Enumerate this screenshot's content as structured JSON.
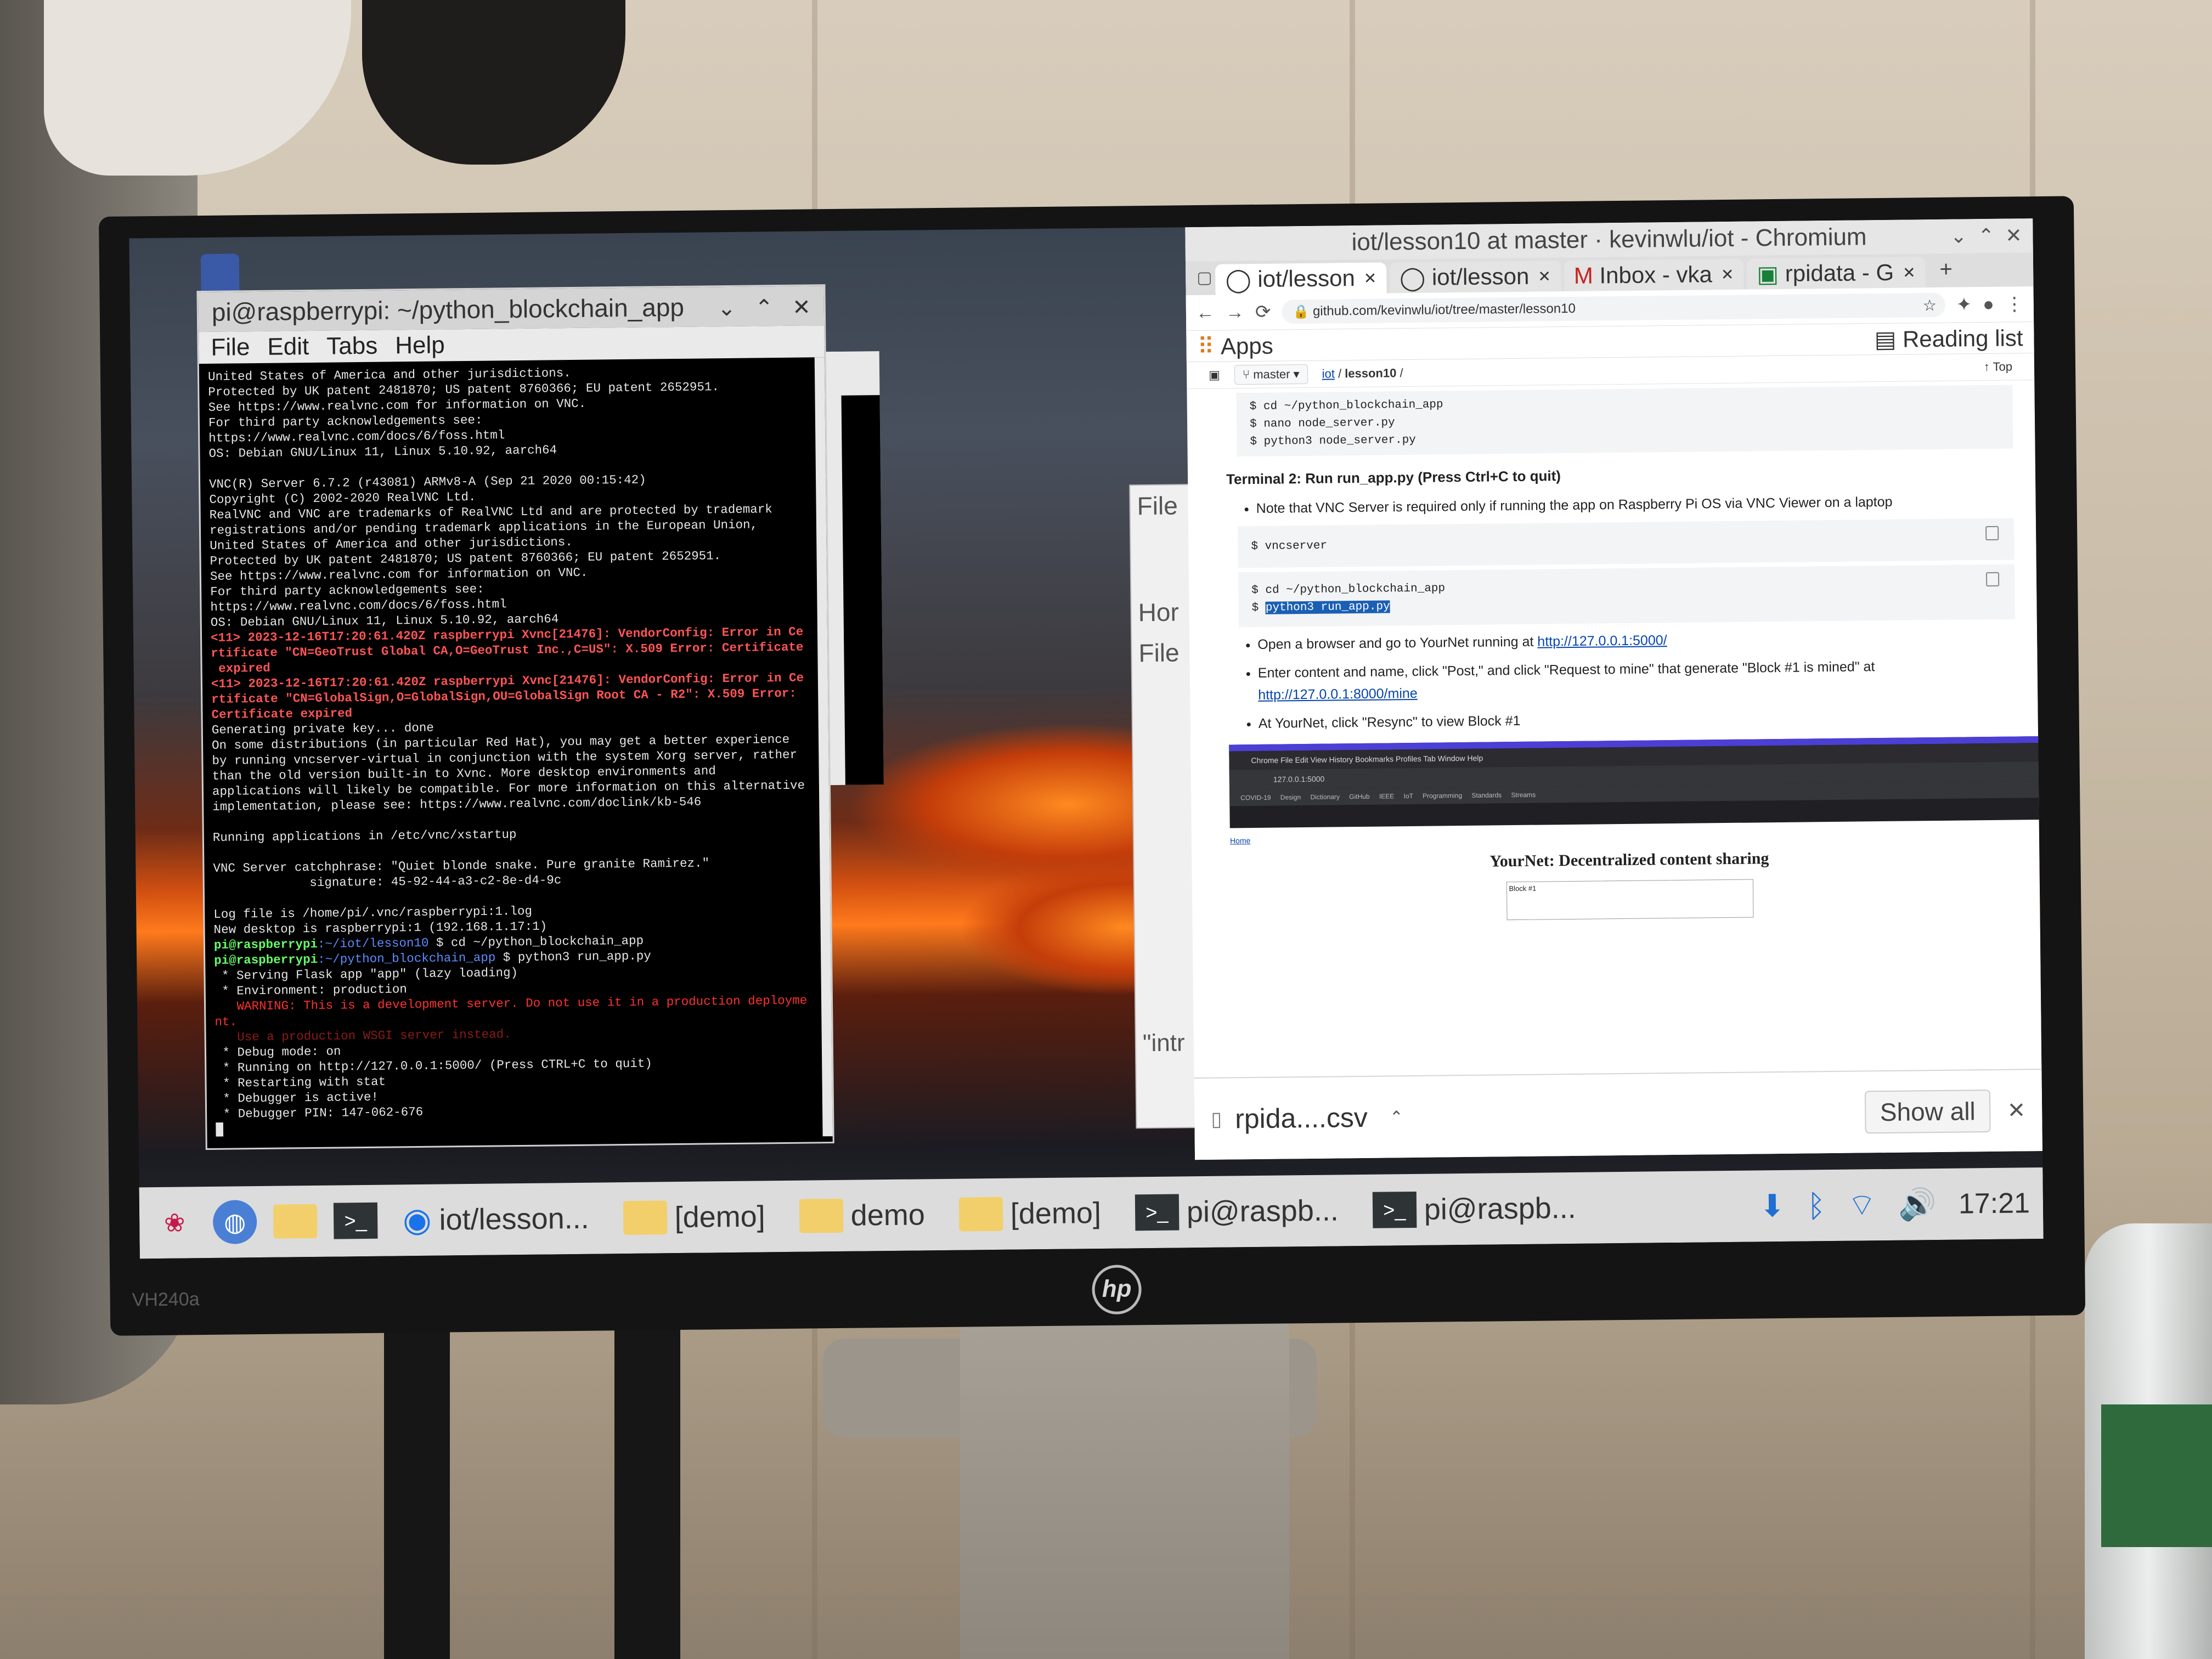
{
  "terminal": {
    "title": "pi@raspberrypi: ~/python_blockchain_app",
    "menu": [
      "File",
      "Edit",
      "Tabs",
      "Help"
    ],
    "lines": [
      {
        "t": "United States of America and other jurisdictions.",
        "c": ""
      },
      {
        "t": "Protected by UK patent 2481870; US patent 8760366; EU patent 2652951.",
        "c": ""
      },
      {
        "t": "See https://www.realvnc.com for information on VNC.",
        "c": ""
      },
      {
        "t": "For third party acknowledgements see:",
        "c": ""
      },
      {
        "t": "https://www.realvnc.com/docs/6/foss.html",
        "c": ""
      },
      {
        "t": "OS: Debian GNU/Linux 11, Linux 5.10.92, aarch64",
        "c": ""
      },
      {
        "t": "",
        "c": ""
      },
      {
        "t": "VNC(R) Server 6.7.2 (r43081) ARMv8-A (Sep 21 2020 00:15:42)",
        "c": ""
      },
      {
        "t": "Copyright (C) 2002-2020 RealVNC Ltd.",
        "c": ""
      },
      {
        "t": "RealVNC and VNC are trademarks of RealVNC Ltd and are protected by trademark",
        "c": ""
      },
      {
        "t": "registrations and/or pending trademark applications in the European Union,",
        "c": ""
      },
      {
        "t": "United States of America and other jurisdictions.",
        "c": ""
      },
      {
        "t": "Protected by UK patent 2481870; US patent 8760366; EU patent 2652951.",
        "c": ""
      },
      {
        "t": "See https://www.realvnc.com for information on VNC.",
        "c": ""
      },
      {
        "t": "For third party acknowledgements see:",
        "c": ""
      },
      {
        "t": "https://www.realvnc.com/docs/6/foss.html",
        "c": ""
      },
      {
        "t": "OS: Debian GNU/Linux 11, Linux 5.10.92, aarch64",
        "c": ""
      },
      {
        "t": "<11> 2023-12-16T17:20:61.420Z raspberrypi Xvnc[21476]: VendorConfig: Error in Ce",
        "c": "red"
      },
      {
        "t": "rtificate \"CN=GeoTrust Global CA,O=GeoTrust Inc.,C=US\": X.509 Error: Certificate",
        "c": "red"
      },
      {
        "t": " expired",
        "c": "red"
      },
      {
        "t": "<11> 2023-12-16T17:20:61.420Z raspberrypi Xvnc[21476]: VendorConfig: Error in Ce",
        "c": "red"
      },
      {
        "t": "rtificate \"CN=GlobalSign,O=GlobalSign,OU=GlobalSign Root CA - R2\": X.509 Error:",
        "c": "red"
      },
      {
        "t": "Certificate expired",
        "c": "red"
      },
      {
        "t": "Generating private key... done",
        "c": ""
      },
      {
        "t": "On some distributions (in particular Red Hat), you may get a better experience",
        "c": ""
      },
      {
        "t": "by running vncserver-virtual in conjunction with the system Xorg server, rather",
        "c": ""
      },
      {
        "t": "than the old version built-in to Xvnc. More desktop environments and",
        "c": ""
      },
      {
        "t": "applications will likely be compatible. For more information on this alternative",
        "c": ""
      },
      {
        "t": "implementation, please see: https://www.realvnc.com/doclink/kb-546",
        "c": ""
      },
      {
        "t": "",
        "c": ""
      },
      {
        "t": "Running applications in /etc/vnc/xstartup",
        "c": ""
      },
      {
        "t": "",
        "c": ""
      },
      {
        "t": "VNC Server catchphrase: \"Quiet blonde snake. Pure granite Ramirez.\"",
        "c": ""
      },
      {
        "t": "             signature: 45-92-44-a3-c2-8e-d4-9c",
        "c": ""
      },
      {
        "t": "",
        "c": ""
      },
      {
        "t": "Log file is /home/pi/.vnc/raspberrypi:1.log",
        "c": ""
      },
      {
        "t": "New desktop is raspberrypi:1 (192.168.1.17:1)",
        "c": ""
      },
      {
        "t": "pi@raspberrypi:~/iot/lesson10 $ cd ~/python_blockchain_app",
        "c": "prompt"
      },
      {
        "t": "pi@raspberrypi:~/python_blockchain_app $ python3 run_app.py",
        "c": "prompt"
      },
      {
        "t": " * Serving Flask app \"app\" (lazy loading)",
        "c": ""
      },
      {
        "t": " * Environment: production",
        "c": ""
      },
      {
        "t": "   WARNING: This is a development server. Do not use it in a production deployme",
        "c": "warn"
      },
      {
        "t": "nt.",
        "c": "warn"
      },
      {
        "t": "   Use a production WSGI server instead.",
        "c": "dim"
      },
      {
        "t": " * Debug mode: on",
        "c": ""
      },
      {
        "t": " * Running on http://127.0.0.1:5000/ (Press CTRL+C to quit)",
        "c": ""
      },
      {
        "t": " * Restarting with stat",
        "c": ""
      },
      {
        "t": " * Debugger is active!",
        "c": ""
      },
      {
        "t": " * Debugger PIN: 147-062-676",
        "c": ""
      },
      {
        "t": "█",
        "c": ""
      }
    ]
  },
  "file_manager": {
    "menu_label": "File",
    "items": [
      "Hor",
      "File"
    ],
    "status": "\"intr"
  },
  "chromium": {
    "window_title": "iot/lesson10 at master · kevinwlu/iot - Chromium",
    "tabs": [
      {
        "label": "iot/lesson",
        "icon": "github-icon"
      },
      {
        "label": "iot/lesson",
        "icon": "github-icon"
      },
      {
        "label": "Inbox - vka",
        "icon": "gmail-icon"
      },
      {
        "label": "rpidata - G",
        "icon": "sheets-icon"
      }
    ],
    "url": "github.com/kevinwlu/iot/tree/master/lesson10",
    "bookmarks_apps": "Apps",
    "reading_list": "Reading list",
    "github": {
      "branch": "master",
      "path_repo": "iot",
      "path_folder": "lesson10",
      "top_label": "Top",
      "code1": [
        "$ cd ~/python_blockchain_app",
        "$ nano node_server.py",
        "$ python3 node_server.py"
      ],
      "heading": "Terminal 2: Run run_app.py (Press Ctrl+C to quit)",
      "note": "Note that VNC Server is required only if running the app on Raspberry Pi OS via VNC Viewer on a laptop",
      "code2": "$ vncserver",
      "code3_line1": "$ cd ~/python_blockchain_app",
      "code3_prompt": "$ ",
      "code3_selected": "python3 run_app.py",
      "bullet1_text": "Open a browser and go to YourNet running at ",
      "bullet1_link": "http://127.0.0.1:5000/",
      "bullet2_text": "Enter content and name, click \"Post,\" and click \"Request to mine\" that generate \"Block #1 is mined\" at",
      "bullet2_link": "http://127.0.0.1:8000/mine",
      "bullet3_text": "At YourNet, click \"Resync\" to view Block #1",
      "mini_tabs": "Chrome   File   Edit   View   History   Bookmarks   Profiles   Tab   Window   Help",
      "mini_addr": "127.0.0.1:5000",
      "mini_bookmarks": "COVID-19 Design Dictionary GitHub IEEE IoT Programming Standards Streams",
      "home_link": "Home",
      "yournet_title": "YourNet: Decentralized content sharing",
      "block_label": "Block #1"
    },
    "download": {
      "file": "rpida....csv",
      "show_all": "Show all"
    }
  },
  "taskbar": {
    "items": [
      {
        "label": "iot/lesson...",
        "icon": "chromium-icon"
      },
      {
        "label": "[demo]",
        "icon": "folder-icon"
      },
      {
        "label": "demo",
        "icon": "folder-icon"
      },
      {
        "label": "[demo]",
        "icon": "folder-icon"
      },
      {
        "label": "pi@raspb...",
        "icon": "terminal-icon"
      },
      {
        "label": "pi@raspb...",
        "icon": "terminal-icon"
      }
    ],
    "clock": "17:21"
  },
  "monitor": {
    "model": "VH240a",
    "brand": "hp"
  }
}
